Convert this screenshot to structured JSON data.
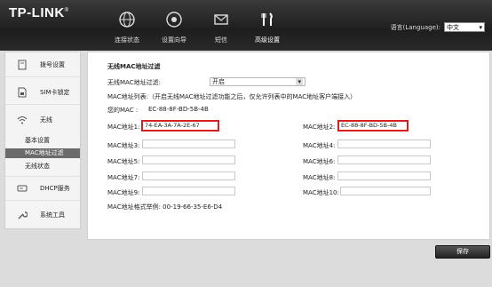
{
  "header": {
    "logo": "TP-LINK",
    "logo_mark": "®",
    "nav": [
      {
        "label": "连接状态",
        "icon": "globe-icon"
      },
      {
        "label": "设置向导",
        "icon": "wizard-icon"
      },
      {
        "label": "短信",
        "icon": "envelope-icon"
      },
      {
        "label": "高级设置",
        "icon": "tools-icon"
      }
    ],
    "language_label": "语言(Language):",
    "language_value": "中文"
  },
  "sidebar": {
    "items": [
      {
        "label": "拨号设置",
        "icon": "dialup-icon"
      },
      {
        "label": "SIM卡锁定",
        "icon": "sim-card-icon"
      },
      {
        "label": "无线",
        "icon": "wifi-icon"
      },
      {
        "label": "DHCP服务",
        "icon": "dhcp-server-icon"
      },
      {
        "label": "系统工具",
        "icon": "wrench-icon"
      }
    ],
    "subitems": [
      {
        "label": "基本设置",
        "active": false
      },
      {
        "label": "MAC地址过滤",
        "active": true
      },
      {
        "label": "无线状态",
        "active": false
      }
    ]
  },
  "main": {
    "section_title": "无线MAC地址过滤",
    "filter_label": "无线MAC地址过滤:",
    "filter_value": "开启",
    "list_note": "MAC地址列表:（开启无线MAC地址过滤功能之后，仅允许列表中的MAC地址客户端接入）",
    "your_mac_label": "您的MAC :",
    "your_mac_value": "EC-88-8F-BD-5B-4B",
    "mac_entries": [
      {
        "label": "MAC地址1:",
        "value": "74-EA-3A-7A-2E-67"
      },
      {
        "label": "MAC地址2:",
        "value": "EC-88-8F-BD-5B-4B"
      },
      {
        "label": "MAC地址3:",
        "value": ""
      },
      {
        "label": "MAC地址4:",
        "value": ""
      },
      {
        "label": "MAC地址5:",
        "value": ""
      },
      {
        "label": "MAC地址6:",
        "value": ""
      },
      {
        "label": "MAC地址7:",
        "value": ""
      },
      {
        "label": "MAC地址8:",
        "value": ""
      },
      {
        "label": "MAC地址9:",
        "value": ""
      },
      {
        "label": "MAC地址10:",
        "value": ""
      }
    ],
    "format_example": "MAC地址格式举例: 00-19-66-35-E6-D4"
  },
  "footer": {
    "save_label": "保存"
  },
  "colors": {
    "highlight": "#d42020",
    "header_bg": "#1e1e1e"
  }
}
